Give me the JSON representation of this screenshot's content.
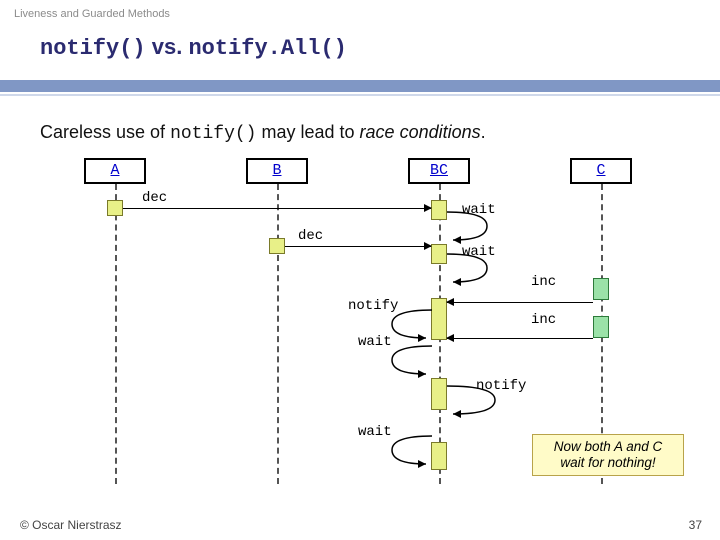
{
  "preheader": "Liveness and Guarded Methods",
  "title": {
    "a": "notify()",
    "b": " vs. ",
    "c": "notify.All()"
  },
  "caption": {
    "pre": "Careless use of ",
    "code": "notify()",
    "mid": " may lead to ",
    "em": "race conditions",
    "post": "."
  },
  "lanes": {
    "a": "A",
    "b": "B",
    "bc": "BC",
    "c": "C"
  },
  "labels": {
    "dec": "dec",
    "wait": "wait",
    "notify": "notify",
    "inc": "inc"
  },
  "note": {
    "l1": "Now both A and C",
    "l2": "wait for nothing!"
  },
  "author": "© Oscar Nierstrasz",
  "page": "37"
}
